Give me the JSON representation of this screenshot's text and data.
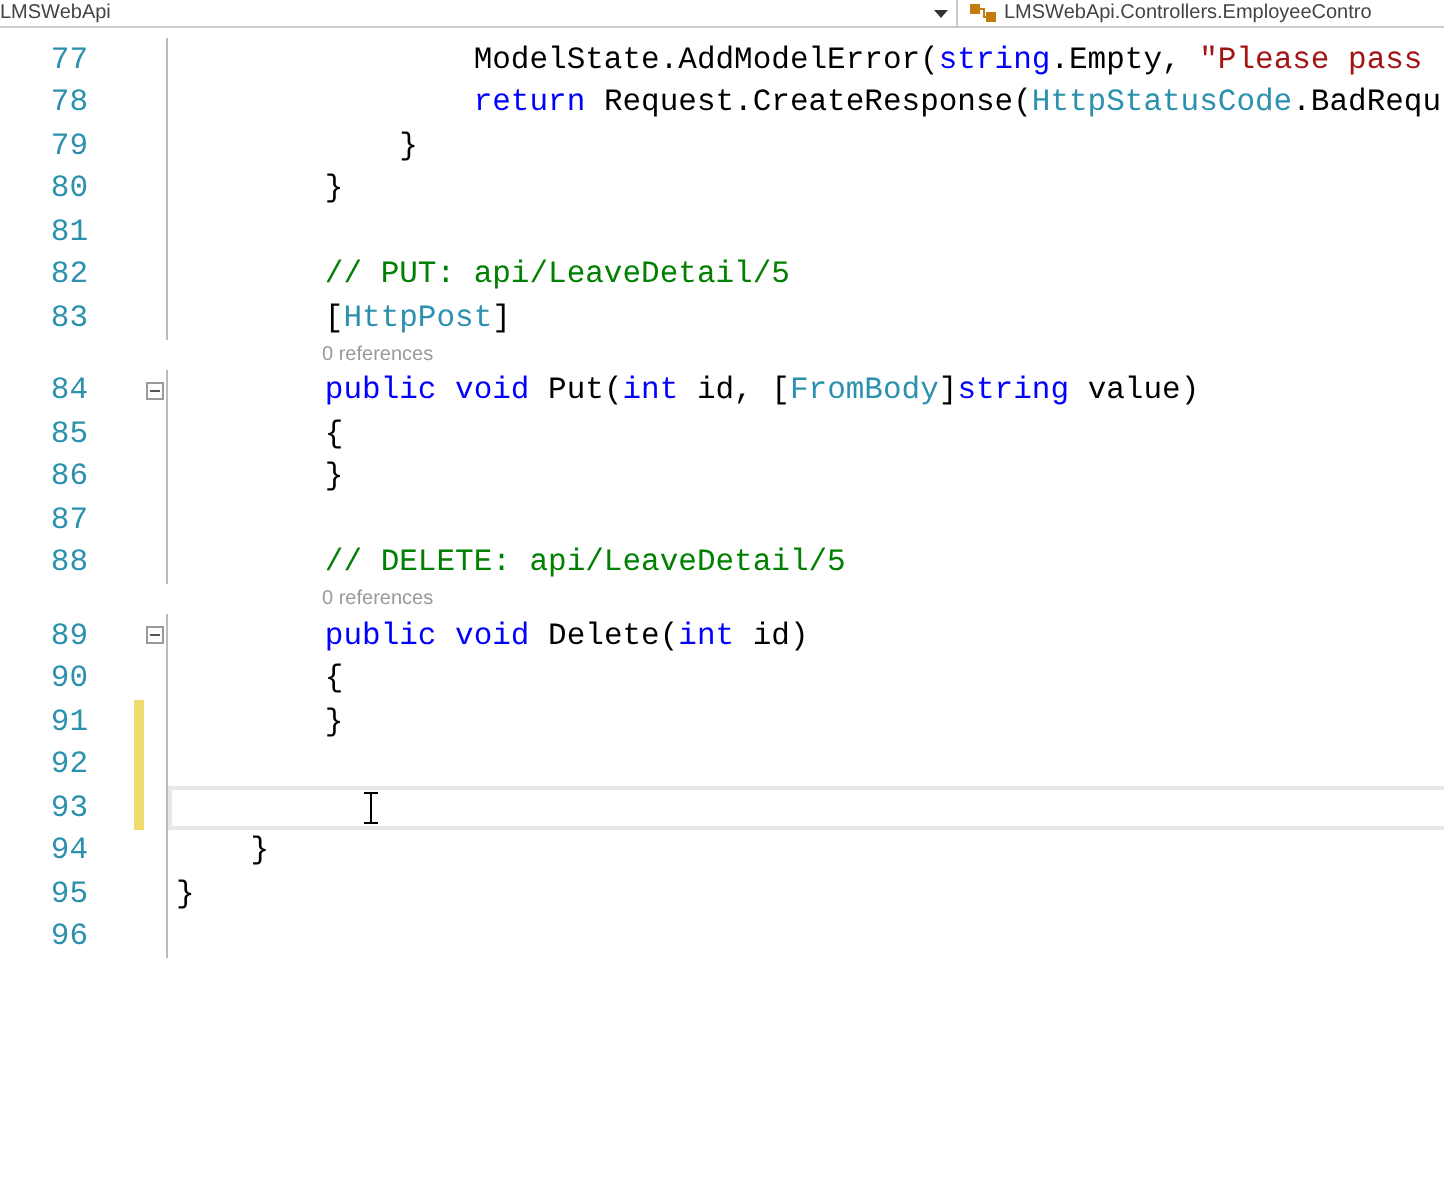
{
  "navigation_bar": {
    "project_dropdown": "LMSWebApi",
    "type_dropdown": "LMSWebApi.Controllers.EmployeeContro"
  },
  "editor": {
    "lines": [
      {
        "kind": "code",
        "number": "77",
        "changed": false,
        "current": false,
        "fold": false,
        "tokens": [
          {
            "kind": "plain",
            "text": "                ModelState.AddModelError("
          },
          {
            "kind": "keyword",
            "text": "string"
          },
          {
            "kind": "plain",
            "text": ".Empty, "
          },
          {
            "kind": "string",
            "text": "\"Please pass"
          }
        ]
      },
      {
        "kind": "code",
        "number": "78",
        "changed": false,
        "current": false,
        "fold": false,
        "tokens": [
          {
            "kind": "keyword",
            "text": "                return"
          },
          {
            "kind": "plain",
            "text": " Request.CreateResponse("
          },
          {
            "kind": "class",
            "text": "HttpStatusCode"
          },
          {
            "kind": "plain",
            "text": ".BadRequ"
          }
        ]
      },
      {
        "kind": "code",
        "number": "79",
        "changed": false,
        "current": false,
        "fold": false,
        "tokens": [
          {
            "kind": "plain",
            "text": "            }"
          }
        ]
      },
      {
        "kind": "code",
        "number": "80",
        "changed": false,
        "current": false,
        "fold": false,
        "tokens": [
          {
            "kind": "plain",
            "text": "        }"
          }
        ]
      },
      {
        "kind": "code",
        "number": "81",
        "changed": false,
        "current": false,
        "fold": false
      },
      {
        "kind": "code",
        "number": "82",
        "changed": false,
        "current": false,
        "fold": false,
        "tokens": [
          {
            "kind": "comment",
            "text": "        // PUT: api/LeaveDetail/5"
          }
        ]
      },
      {
        "kind": "code",
        "number": "83",
        "changed": false,
        "current": false,
        "fold": false,
        "tokens": [
          {
            "kind": "plain",
            "text": "        ["
          },
          {
            "kind": "class",
            "text": "HttpPost"
          },
          {
            "kind": "plain",
            "text": "]"
          }
        ]
      },
      {
        "kind": "codelens",
        "text": "0 references"
      },
      {
        "kind": "code",
        "number": "84",
        "changed": false,
        "current": false,
        "fold": true,
        "tokens": [
          {
            "kind": "keyword",
            "text": "        public void"
          },
          {
            "kind": "plain",
            "text": " Put("
          },
          {
            "kind": "keyword",
            "text": "int"
          },
          {
            "kind": "plain",
            "text": " id, ["
          },
          {
            "kind": "class",
            "text": "FromBody"
          },
          {
            "kind": "plain",
            "text": "]"
          },
          {
            "kind": "keyword",
            "text": "string"
          },
          {
            "kind": "plain",
            "text": " value)"
          }
        ]
      },
      {
        "kind": "code",
        "number": "85",
        "changed": false,
        "current": false,
        "fold": false,
        "tokens": [
          {
            "kind": "plain",
            "text": "        {"
          }
        ]
      },
      {
        "kind": "code",
        "number": "86",
        "changed": false,
        "current": false,
        "fold": false,
        "tokens": [
          {
            "kind": "plain",
            "text": "        }"
          }
        ]
      },
      {
        "kind": "code",
        "number": "87",
        "changed": false,
        "current": false,
        "fold": false
      },
      {
        "kind": "code",
        "number": "88",
        "changed": false,
        "current": false,
        "fold": false,
        "tokens": [
          {
            "kind": "comment",
            "text": "        // DELETE: api/LeaveDetail/5"
          }
        ]
      },
      {
        "kind": "codelens",
        "text": "0 references"
      },
      {
        "kind": "code",
        "number": "89",
        "changed": false,
        "current": false,
        "fold": true,
        "tokens": [
          {
            "kind": "keyword",
            "text": "        public void"
          },
          {
            "kind": "plain",
            "text": " Delete("
          },
          {
            "kind": "keyword",
            "text": "int"
          },
          {
            "kind": "plain",
            "text": " id)"
          }
        ]
      },
      {
        "kind": "code",
        "number": "90",
        "changed": false,
        "current": false,
        "fold": false,
        "tokens": [
          {
            "kind": "plain",
            "text": "        {"
          }
        ]
      },
      {
        "kind": "code",
        "number": "91",
        "changed": true,
        "current": false,
        "fold": false,
        "tokens": [
          {
            "kind": "plain",
            "text": "        }"
          }
        ]
      },
      {
        "kind": "code",
        "number": "92",
        "changed": true,
        "current": false,
        "fold": false
      },
      {
        "kind": "code",
        "number": "93",
        "changed": true,
        "current": true,
        "fold": false
      },
      {
        "kind": "code",
        "number": "94",
        "changed": false,
        "current": false,
        "fold": false,
        "tokens": [
          {
            "kind": "plain",
            "text": "    }"
          }
        ]
      },
      {
        "kind": "code",
        "number": "95",
        "changed": false,
        "current": false,
        "fold": false,
        "tokens": [
          {
            "kind": "plain",
            "text": "}"
          }
        ]
      },
      {
        "kind": "code",
        "number": "96",
        "changed": false,
        "current": false,
        "fold": false
      }
    ]
  }
}
